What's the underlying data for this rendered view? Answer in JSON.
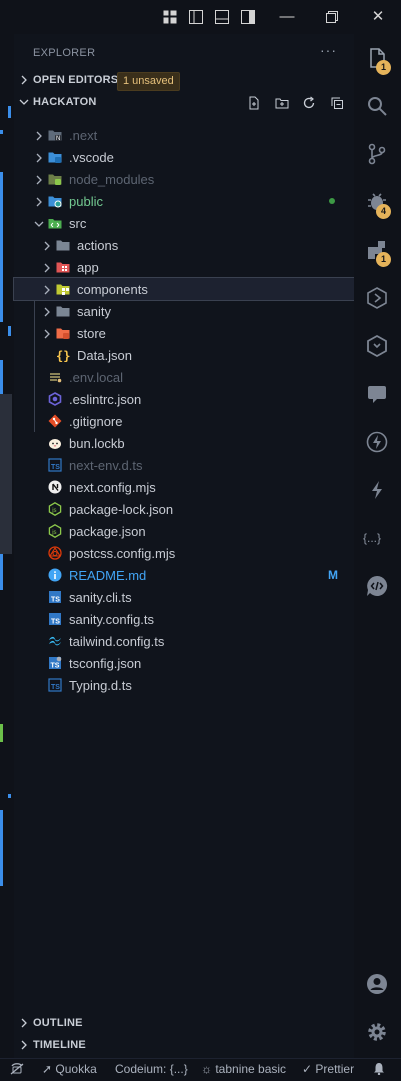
{
  "colors": {
    "accent": "#3b8eea",
    "badge": "#e5b35a",
    "modified": "#42a5f5",
    "untracked": "#73c991"
  },
  "explorer": {
    "title": "EXPLORER",
    "more": "···",
    "open_editors": {
      "label": "OPEN EDITORS",
      "badge": "1 unsaved"
    },
    "workspace": {
      "label": "HACKATON"
    },
    "outline": {
      "label": "OUTLINE"
    },
    "timeline": {
      "label": "TIMELINE"
    }
  },
  "tree": [
    {
      "label": ".next",
      "icon": "folder-next-icon",
      "depth": 0,
      "folder": true,
      "dim": true
    },
    {
      "label": ".vscode",
      "icon": "folder-vscode-icon",
      "depth": 0,
      "folder": true
    },
    {
      "label": "node_modules",
      "icon": "folder-node-icon",
      "depth": 0,
      "folder": true,
      "dim": true
    },
    {
      "label": "public",
      "icon": "folder-public-icon",
      "depth": 0,
      "folder": true,
      "color": "#73c991",
      "dot": true
    },
    {
      "label": "src",
      "icon": "folder-src-icon",
      "depth": 0,
      "folder": true,
      "open": true
    },
    {
      "label": "actions",
      "icon": "folder-icon",
      "depth": 1,
      "folder": true
    },
    {
      "label": "app",
      "icon": "folder-app-icon",
      "depth": 1,
      "folder": true
    },
    {
      "label": "components",
      "icon": "folder-components-icon",
      "depth": 1,
      "folder": true,
      "selected": true
    },
    {
      "label": "sanity",
      "icon": "folder-icon",
      "depth": 1,
      "folder": true
    },
    {
      "label": "store",
      "icon": "folder-store-icon",
      "depth": 1,
      "folder": true
    },
    {
      "label": "Data.json",
      "icon": "json-braces-icon",
      "depth": 1
    },
    {
      "label": ".env.local",
      "icon": "env-icon",
      "depth": 0,
      "dim": true
    },
    {
      "label": ".eslintrc.json",
      "icon": "eslint-icon",
      "depth": 0
    },
    {
      "label": ".gitignore",
      "icon": "git-icon",
      "depth": 0
    },
    {
      "label": "bun.lockb",
      "icon": "bun-icon",
      "depth": 0
    },
    {
      "label": "next-env.d.ts",
      "icon": "typescript-def-icon",
      "depth": 0,
      "dim": true
    },
    {
      "label": "next.config.mjs",
      "icon": "nextjs-icon",
      "depth": 0
    },
    {
      "label": "package-lock.json",
      "icon": "nodejs-icon",
      "depth": 0
    },
    {
      "label": "package.json",
      "icon": "nodejs-icon",
      "depth": 0
    },
    {
      "label": "postcss.config.mjs",
      "icon": "postcss-icon",
      "depth": 0
    },
    {
      "label": "README.md",
      "icon": "info-icon",
      "depth": 0,
      "color": "#42a5f5",
      "deco": "M"
    },
    {
      "label": "sanity.cli.ts",
      "icon": "typescript-icon",
      "depth": 0
    },
    {
      "label": "sanity.config.ts",
      "icon": "typescript-icon",
      "depth": 0
    },
    {
      "label": "tailwind.config.ts",
      "icon": "tailwind-icon",
      "depth": 0
    },
    {
      "label": "tsconfig.json",
      "icon": "tsconfig-icon",
      "depth": 0
    },
    {
      "label": "Typing.d.ts",
      "icon": "typescript-def-icon",
      "depth": 0
    }
  ],
  "activity": {
    "explorer_badge": "1",
    "debug_badge": "4",
    "extensions_badge": "1",
    "snippets_label": "{...}"
  },
  "status": {
    "quokka": "Quokka",
    "codeium": "Codeium: {...}",
    "tabnine": "tabnine basic",
    "prettier": "Prettier"
  }
}
